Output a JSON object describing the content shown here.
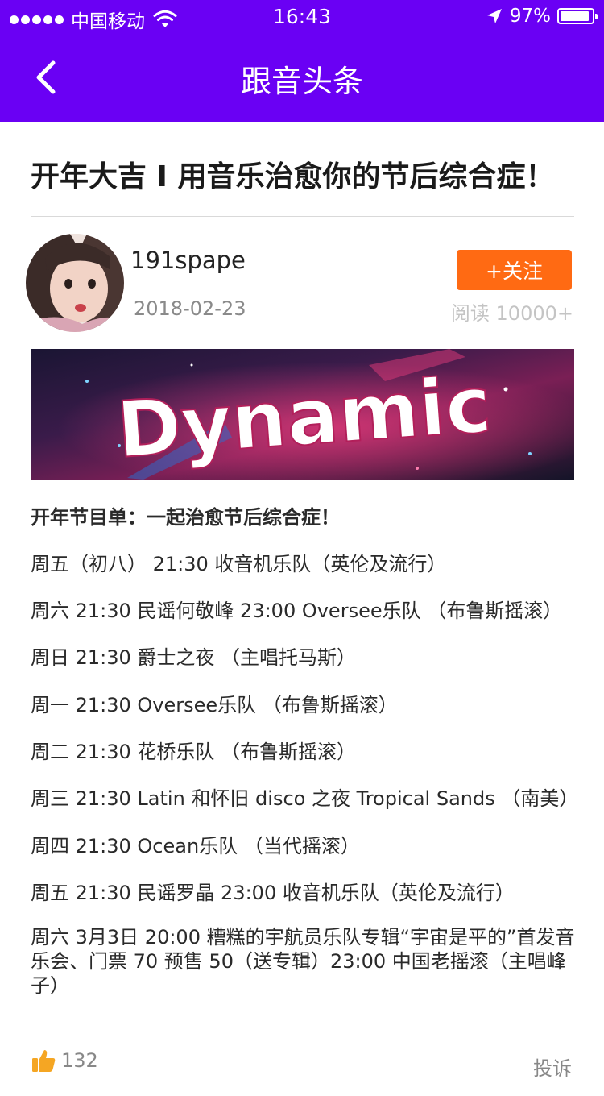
{
  "status_bar": {
    "carrier": "中国移动",
    "time": "16:43",
    "battery_percent": "97%",
    "battery_level": 0.97,
    "signal_dots": 5
  },
  "nav": {
    "back_icon": "chevron-left-icon",
    "title": "跟音头条"
  },
  "article": {
    "title": "开年大吉 I 用音乐治愈你的节后综合症！",
    "author": "191spape",
    "date": "2018-02-23",
    "follow_label": "+关注",
    "reads": "阅读 10000+",
    "banner_text": "Dynamic",
    "headline": "开年节目单：一起治愈节后综合症！",
    "lines": [
      "周五（初八） 21:30 收音机乐队（英伦及流行）",
      "周六 21:30 民谣何敬峰 23:00 Oversee乐队 （布鲁斯摇滚）",
      "周日 21:30 爵士之夜 （主唱托马斯）",
      "周一 21:30 Oversee乐队 （布鲁斯摇滚）",
      "周二 21:30 花桥乐队 （布鲁斯摇滚）",
      "周三 21:30 Latin 和怀旧 disco 之夜 Tropical Sands （南美）",
      "周四 21:30 Ocean乐队 （当代摇滚）",
      "周五 21:30 民谣罗晶 23:00 收音机乐队（英伦及流行）"
    ],
    "last_paragraph": "周六 3月3日 20:00 糟糕的宇航员乐队专辑“宇宙是平的”首发音乐会、门票 70 预售 50（送专辑）23:00 中国老摇滚（主唱峰子）"
  },
  "footer": {
    "like_count": "132",
    "report_label": "投诉"
  },
  "colors": {
    "header_bg": "#6a00f4",
    "follow_bg": "#ff6a13",
    "like_icon": "#f5a623"
  }
}
